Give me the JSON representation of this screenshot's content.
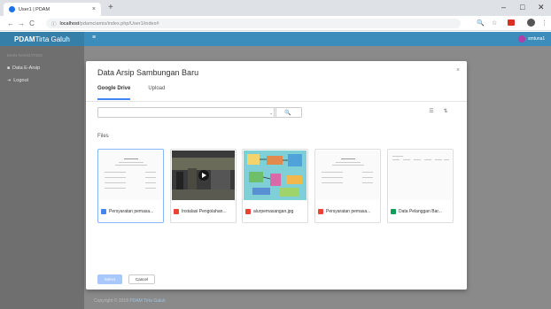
{
  "browser": {
    "tab_title": "User1 | PDAM",
    "tab_close": "×",
    "new_tab": "+",
    "url_host": "localhost",
    "url_path": "/pdamciamis/index.php/User1/index#",
    "back": "←",
    "forward": "→",
    "reload": "C",
    "info": "ⓘ",
    "zoom": "🔍",
    "star": "☆",
    "menu": "⋮",
    "win_min": "–",
    "win_max": "□",
    "win_close": "✕"
  },
  "app": {
    "brand_bold": "PDAM",
    "brand_rest": "Tirta Galuh",
    "hamburger": "≡",
    "user_name": "smtuna1",
    "sidebar_heading": "MAIN NAVIGATION",
    "sidebar_items": [
      {
        "label": "Data E-Arsip",
        "icon": "■"
      },
      {
        "label": "Logout",
        "icon": "⇥"
      }
    ],
    "footer_prefix": "Copyright © 2018 ",
    "footer_link": "PDAM Tirta Galuh"
  },
  "modal": {
    "title": "Data Arsip Sambungan Baru",
    "close": "×",
    "tabs": [
      {
        "label": "Google Drive",
        "active": true
      },
      {
        "label": "Upload",
        "active": false
      }
    ],
    "search_icon": "🔍",
    "caret": "⌄",
    "view_icon": "☰",
    "sort_icon": "⇅",
    "files_label": "Files",
    "files": [
      {
        "name": "Persyaratan pemasa...",
        "type": "doc",
        "icon_color": "#4285f4"
      },
      {
        "name": "Instalasi Pengolahan...",
        "type": "video",
        "icon_color": "#ea4335"
      },
      {
        "name": "alurpemasangan.jpg",
        "type": "image",
        "icon_color": "#ea4335"
      },
      {
        "name": "Persyaratan pemasa...",
        "type": "pdf",
        "icon_color": "#ea4335"
      },
      {
        "name": "Data Pelanggan Bar...",
        "type": "sheet",
        "icon_color": "#0f9d58"
      }
    ],
    "select_label": "Select",
    "cancel_label": "Cancel"
  },
  "colors": {
    "header": "#3c8dbc",
    "brand_bg": "#367fa9",
    "sidebar": "#6f6f6f",
    "accent": "#4285f4"
  }
}
